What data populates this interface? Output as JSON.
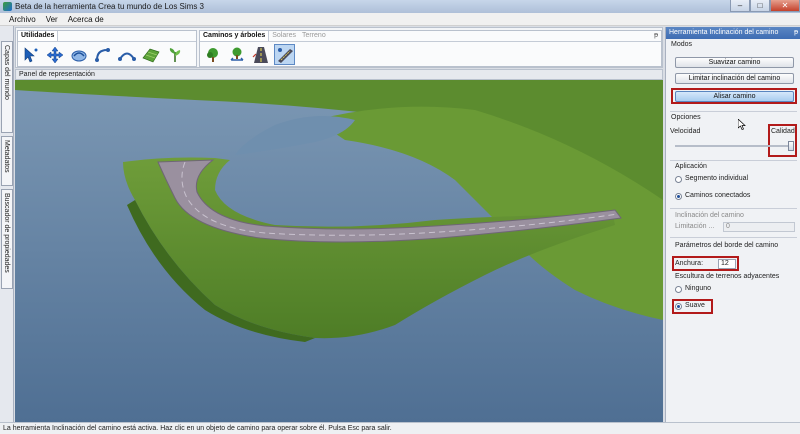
{
  "window": {
    "title": "Beta de la herramienta Crea tu mundo de Los Sims 3",
    "minimize_glyph": "–",
    "maximize_glyph": "□",
    "close_glyph": "✕"
  },
  "menu": {
    "items": [
      "Archivo",
      "Ver",
      "Acerca de"
    ]
  },
  "left_tabs": [
    "Capas del mundo",
    "Metadatos",
    "Buscador de propiedades"
  ],
  "toolbar": {
    "utilities_tab": "Utilidades",
    "paths_tabs": [
      "Caminos y árboles",
      "Solares",
      "Terreno"
    ],
    "pin_glyph": "ᵽ",
    "utility_icons": [
      "select-arrow-icon",
      "move-icon",
      "route-icon",
      "curve-left-icon",
      "curve-right-icon",
      "terrain-paint-icon",
      "plant-icon"
    ],
    "path_icons": [
      "tree-icon",
      "tree-move-icon",
      "road-icon",
      "road-slope-icon"
    ]
  },
  "viewport": {
    "label": "Panel de representación"
  },
  "right_panel": {
    "title": "Herramienta Inclinación del camino",
    "modes_label": "Modos",
    "buttons": {
      "smooth": "Suavizar camino",
      "limit": "Limitar inclinación del camino",
      "flatten": "Alisar camino"
    },
    "options_label": "Opciones",
    "speed_label": "Velocidad",
    "quality_label": "Calidad",
    "application_label": "Aplicación",
    "radio_single": "Segmento individual",
    "radio_connected": "Caminos conectados",
    "slope_label": "Inclinación del camino",
    "limit_label": "Limitación ...",
    "limit_value": "0",
    "edge_params_label": "Parámetros del borde del camino",
    "width_label": "Anchura:",
    "width_value": "12",
    "sculpt_label": "Escultura de terrenos adyacentes",
    "radio_none": "Ninguno",
    "radio_smooth": "Suave",
    "selected_mode": "flatten",
    "application_selected": "connected",
    "sculpt_selected": "smooth"
  },
  "status": "La herramienta Inclinación del camino está activa. Haz clic en un objeto de camino para operar sobre él. Pulsa Esc para salir.",
  "colors": {
    "accent": "#3e6db3",
    "highlight": "#b21a1a",
    "grass": "#5f8f2e",
    "water": "#5f7fa2",
    "road": "#8f8698"
  }
}
